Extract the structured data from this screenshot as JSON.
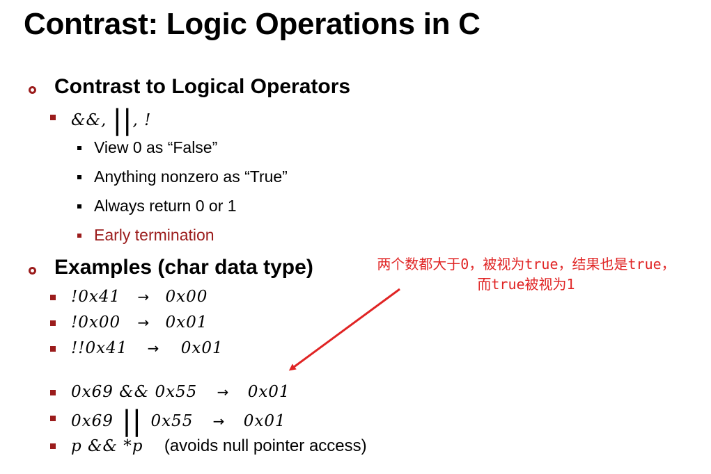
{
  "title": "Contrast: Logic Operations in C",
  "section1": {
    "heading": "Contrast to Logical Operators",
    "ops_prefix": "&&, ",
    "ops_bars": "||",
    "ops_suffix": ", !",
    "items": [
      "View 0 as “False”",
      "Anything nonzero as “True”",
      "Always return 0 or 1",
      "Early termination"
    ]
  },
  "section2": {
    "heading": "Examples (char data type)",
    "arrow": "→",
    "examples": [
      {
        "expr": "!0x41",
        "result": "0x00"
      },
      {
        "expr": "!0x00",
        "result": "0x01"
      },
      {
        "expr": "!!0x41",
        "result": "0x01"
      },
      {
        "expr": "0x69 && 0x55",
        "result": "0x01"
      },
      {
        "expr_left": "0x69",
        "expr_bars": "||",
        "expr_right": "0x55",
        "result": "0x01"
      },
      {
        "expr": "p && *p",
        "note": "(avoids null pointer access)"
      }
    ]
  },
  "annotation": {
    "line1": "两个数都大于0，被视为true，结果也是true，",
    "line2": "而true被视为1",
    "color": "#e02424"
  },
  "colors": {
    "bullet": "#9b1c1c",
    "highlight": "#9b1c1c"
  }
}
